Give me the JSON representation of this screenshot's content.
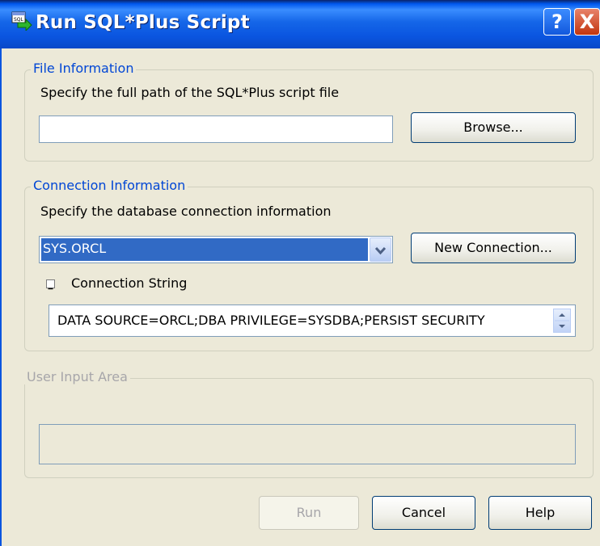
{
  "window": {
    "title": "Run SQL*Plus Script",
    "icon": "sql-script-icon",
    "help_label": "?",
    "close_label": "X"
  },
  "file_info": {
    "legend": "File Information",
    "instruction": "Specify the full path of the SQL*Plus script file",
    "path_value": "",
    "browse_label": "Browse..."
  },
  "connection_info": {
    "legend": "Connection Information",
    "instruction": "Specify the database connection information",
    "selected_connection": "SYS.ORCL",
    "new_connection_label": "New Connection...",
    "connection_string_label": "Connection String",
    "connection_string_value": "DATA SOURCE=ORCL;DBA PRIVILEGE=SYSDBA;PERSIST SECURITY"
  },
  "user_input": {
    "legend": "User Input Area",
    "value": ""
  },
  "buttons": {
    "run": "Run",
    "cancel": "Cancel",
    "help": "Help"
  },
  "colors": {
    "title_bar": "#0A55E0",
    "selection": "#316AC5",
    "legend_text": "#0046D5",
    "disabled_text": "#A7A6AA",
    "face": "#ECE9D8"
  }
}
